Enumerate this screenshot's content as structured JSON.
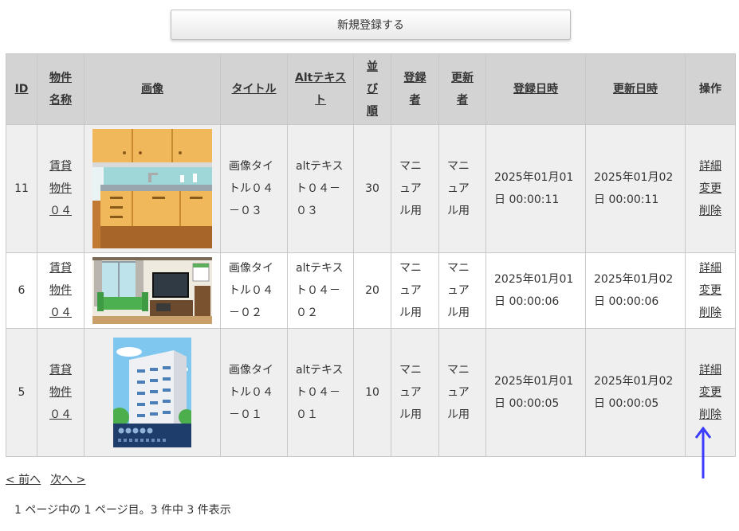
{
  "actions": {
    "new_button": "新規登録する"
  },
  "table": {
    "headers": {
      "id": "ID",
      "property_l1": "物件",
      "property_l2": "名称",
      "image": "画像",
      "title": "タイトル",
      "alt_l1": "Altテキス",
      "alt_l2": "ト",
      "order_l1": "並",
      "order_l2": "び",
      "order_l3": "順",
      "creator_l1": "登録",
      "creator_l2": "者",
      "updater_l1": "更新",
      "updater_l2": "者",
      "created_at": "登録日時",
      "updated_at": "更新日時",
      "operations": "操作"
    },
    "rows": [
      {
        "id": "11",
        "property": [
          "賃貸",
          "物件",
          "０４"
        ],
        "image_alt": "kitchen illustration",
        "title": [
          "画像タイ",
          "トル０４",
          "－０３"
        ],
        "alt": [
          "altテキス",
          "ト０４－",
          "０３"
        ],
        "order": "30",
        "creator": [
          "マニ",
          "ュア",
          "ル用"
        ],
        "updater": [
          "マニ",
          "ュア",
          "ル用"
        ],
        "created_at": [
          "2025年01月01",
          "日 00:00:11"
        ],
        "updated_at": [
          "2025年01月02",
          "日 00:00:11"
        ],
        "ops": [
          "詳細",
          "変更",
          "削除"
        ]
      },
      {
        "id": "6",
        "property": [
          "賃貸",
          "物件",
          "０４"
        ],
        "image_alt": "living room illustration",
        "title": [
          "画像タイ",
          "トル０４",
          "－０２"
        ],
        "alt": [
          "altテキス",
          "ト０４－",
          "０２"
        ],
        "order": "20",
        "creator": [
          "マニ",
          "ュア",
          "ル用"
        ],
        "updater": [
          "マニ",
          "ュア",
          "ル用"
        ],
        "created_at": [
          "2025年01月01",
          "日 00:00:06"
        ],
        "updated_at": [
          "2025年01月02",
          "日 00:00:06"
        ],
        "ops": [
          "詳細",
          "変更",
          "削除"
        ]
      },
      {
        "id": "5",
        "property": [
          "賃貸",
          "物件",
          "０４"
        ],
        "image_alt": "apartment building illustration",
        "title": [
          "画像タイ",
          "トル０４",
          "－０１"
        ],
        "alt": [
          "altテキス",
          "ト０４－",
          "０１"
        ],
        "order": "10",
        "creator": [
          "マニ",
          "ュア",
          "ル用"
        ],
        "updater": [
          "マニ",
          "ュア",
          "ル用"
        ],
        "created_at": [
          "2025年01月01",
          "日 00:00:05"
        ],
        "updated_at": [
          "2025年01月02",
          "日 00:00:05"
        ],
        "ops": [
          "詳細",
          "変更",
          "削除"
        ]
      }
    ]
  },
  "pager": {
    "prev": "< 前へ",
    "next": "次へ >"
  },
  "summary": "1 ページ中の 1 ページ目。3 件中 3 件表示",
  "annotation": {
    "arrow_color": "#3b3bff"
  }
}
